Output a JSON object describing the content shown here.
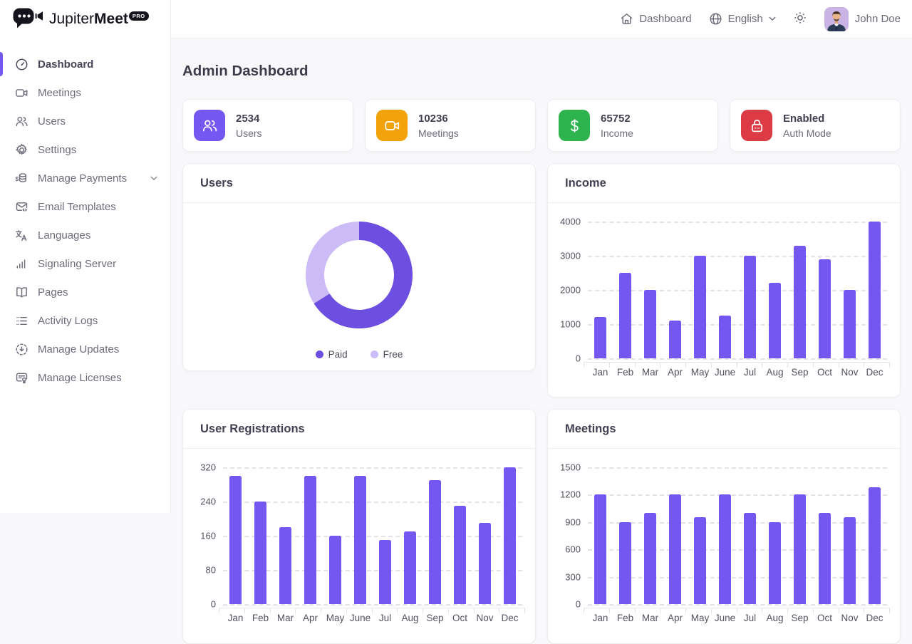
{
  "brand": {
    "logo_icon": "video-chat-icon",
    "name_regular": "Jupiter",
    "name_bold": "Meet",
    "badge": "PRO"
  },
  "topbar": {
    "dashboard_label": "Dashboard",
    "language": "English",
    "user_name": "John Doe",
    "icons": [
      "home-icon",
      "globe-icon",
      "chevron-down-icon",
      "sun-icon",
      "avatar"
    ]
  },
  "sidebar": {
    "items": [
      {
        "label": "Dashboard",
        "icon": "dashboard-icon",
        "active": true
      },
      {
        "label": "Meetings",
        "icon": "video-icon"
      },
      {
        "label": "Users",
        "icon": "users-icon"
      },
      {
        "label": "Settings",
        "icon": "gear-icon"
      },
      {
        "label": "Manage Payments",
        "icon": "payments-icon",
        "has_submenu": true
      },
      {
        "label": "Email Templates",
        "icon": "email-code-icon"
      },
      {
        "label": "Languages",
        "icon": "translate-icon"
      },
      {
        "label": "Signaling Server",
        "icon": "signal-icon"
      },
      {
        "label": "Pages",
        "icon": "book-icon"
      },
      {
        "label": "Activity Logs",
        "icon": "list-icon"
      },
      {
        "label": "Manage Updates",
        "icon": "update-icon"
      },
      {
        "label": "Manage Licenses",
        "icon": "license-icon"
      }
    ]
  },
  "page": {
    "title": "Admin Dashboard"
  },
  "stats": [
    {
      "value": "2534",
      "label": "Users",
      "icon": "users-icon",
      "color": "#7557F1"
    },
    {
      "value": "10236",
      "label": "Meetings",
      "icon": "video-icon",
      "color": "#F2A30B"
    },
    {
      "value": "65752",
      "label": "Income",
      "icon": "dollar-icon",
      "color": "#2EB44E"
    },
    {
      "value": "Enabled",
      "label": "Auth Mode",
      "icon": "lock-icon",
      "color": "#DC3B45"
    }
  ],
  "chart_data": [
    {
      "type": "pie",
      "subtype": "donut",
      "title": "Users",
      "legend_position": "bottom",
      "series": [
        {
          "name": "Paid",
          "value": 66,
          "color": "#6C4EE0"
        },
        {
          "name": "Free",
          "value": 34,
          "color": "#CBBCF7"
        }
      ],
      "unit": "percent"
    },
    {
      "type": "bar",
      "title": "Income",
      "categories": [
        "Jan",
        "Feb",
        "Mar",
        "Apr",
        "May",
        "June",
        "Jul",
        "Aug",
        "Sep",
        "Oct",
        "Nov",
        "Dec"
      ],
      "values": [
        1200,
        2500,
        2000,
        1100,
        3000,
        1250,
        3000,
        2200,
        3300,
        2900,
        2000,
        4000
      ],
      "yticks": [
        4000,
        3000,
        2000,
        1000,
        0
      ],
      "ylim": [
        0,
        4000
      ],
      "bar_color": "#7457F0",
      "grid": "dashed-horizontal"
    },
    {
      "type": "bar",
      "title": "User Registrations",
      "categories": [
        "Jan",
        "Feb",
        "Mar",
        "Apr",
        "May",
        "June",
        "Jul",
        "Aug",
        "Sep",
        "Oct",
        "Nov",
        "Dec"
      ],
      "values": [
        300,
        240,
        180,
        300,
        160,
        300,
        150,
        170,
        290,
        230,
        190,
        320
      ],
      "yticks": [
        320,
        240,
        160,
        80,
        0
      ],
      "ylim": [
        0,
        320
      ],
      "bar_color": "#7457F0",
      "grid": "dashed-horizontal"
    },
    {
      "type": "bar",
      "title": "Meetings",
      "categories": [
        "Jan",
        "Feb",
        "Mar",
        "Apr",
        "May",
        "June",
        "Jul",
        "Aug",
        "Sep",
        "Oct",
        "Nov",
        "Dec"
      ],
      "values": [
        1200,
        900,
        1000,
        1200,
        950,
        1200,
        1000,
        900,
        1200,
        1000,
        950,
        1280
      ],
      "yticks": [
        1500,
        1200,
        900,
        600,
        300,
        0
      ],
      "ylim": [
        0,
        1500
      ],
      "bar_color": "#7457F0",
      "grid": "dashed-horizontal"
    }
  ]
}
